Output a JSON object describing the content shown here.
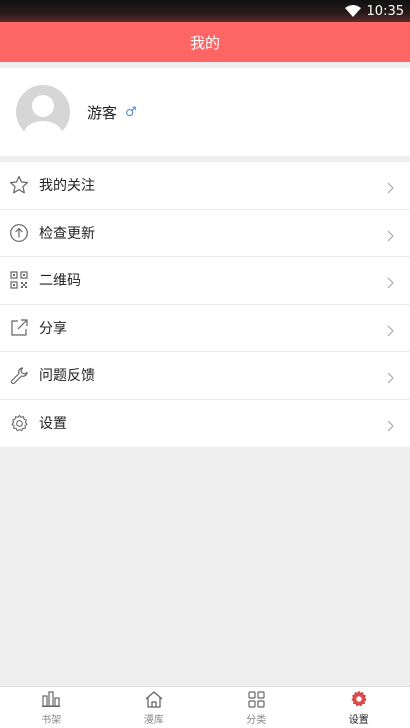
{
  "status_bar": {
    "time": "10:35"
  },
  "header": {
    "title": "我的"
  },
  "profile": {
    "name": "游客",
    "gender_symbol": "♂"
  },
  "menu": [
    {
      "label": "我的关注",
      "icon": "star-icon"
    },
    {
      "label": "检查更新",
      "icon": "arrow-up-circle-icon"
    },
    {
      "label": "二维码",
      "icon": "qr-code-icon"
    },
    {
      "label": "分享",
      "icon": "share-icon"
    },
    {
      "label": "问题反馈",
      "icon": "wrench-icon"
    },
    {
      "label": "设置",
      "icon": "gear-icon"
    }
  ],
  "tabs": [
    {
      "label": "书架",
      "icon": "bookshelf-icon",
      "active": false
    },
    {
      "label": "漫库",
      "icon": "home-icon",
      "active": false
    },
    {
      "label": "分类",
      "icon": "grid-icon",
      "active": false
    },
    {
      "label": "设置",
      "icon": "gear-icon",
      "active": true
    }
  ],
  "colors": {
    "accent": "#fe6565",
    "active_tab_icon": "#e04b4b",
    "gender": "#4a8fd8"
  }
}
